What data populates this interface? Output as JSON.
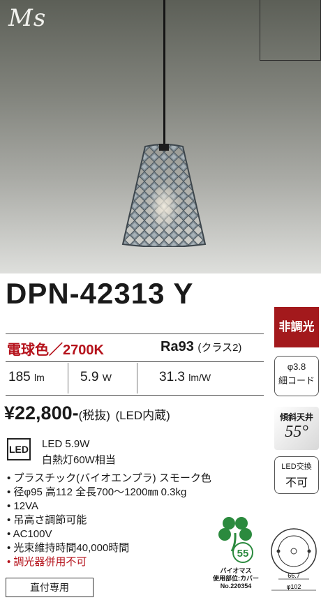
{
  "brand": "Ms",
  "model": "DPN-42313 Y",
  "color_temp": "電球色／2700K",
  "ra": {
    "main": "Ra93",
    "sub": "(クラス2)"
  },
  "specs": [
    {
      "value": "185",
      "unit": "lm"
    },
    {
      "value": "5.9",
      "unit": "W"
    },
    {
      "value": "31.3",
      "unit": "lm/W"
    }
  ],
  "price": {
    "amount": "¥22,800-",
    "tax": "(税抜)",
    "note": "(LED内蔵)"
  },
  "led": {
    "badge": "LED",
    "line1": "LED 5.9W",
    "line2": "白熱灯60W相当"
  },
  "features": [
    "• プラスチック(バイオエンプラ) スモーク色",
    "• 径φ95 高112 全長700〜1200㎜ 0.3kg",
    "• 12VA",
    "• 吊高さ調節可能",
    "• AC100V",
    "• 光束維持時間40,000時間",
    "• 調光器併用不可"
  ],
  "side": {
    "dimmer": "非調光",
    "cord": [
      "φ3.8",
      "細コード"
    ],
    "slope_label": "傾斜天井",
    "slope_value": "55°",
    "led_exchange": [
      "LED交換",
      "不可"
    ]
  },
  "biomass": {
    "mark": "55",
    "lines": [
      "バイオマス",
      "使用部位:カバー",
      "No.220354"
    ]
  },
  "diagram": {
    "dim_inner": "66.7",
    "dim_outer": "φ102"
  },
  "footer": "直付専用",
  "colors": {
    "accent_red": "#b5121b",
    "badge_red": "#a3191c",
    "bio_green": "#2b8a3e"
  }
}
